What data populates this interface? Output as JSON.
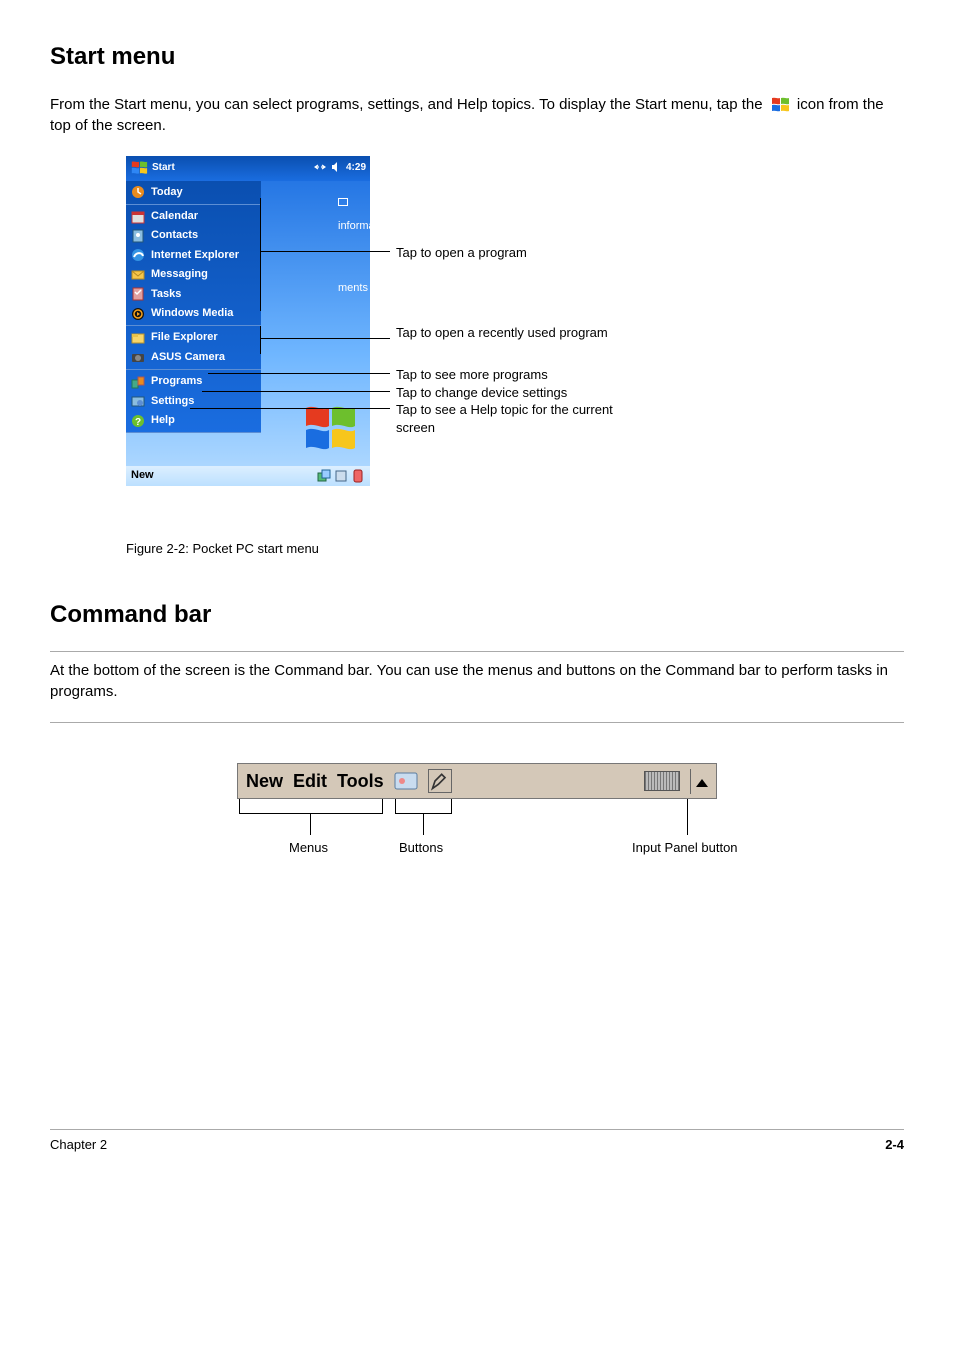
{
  "section1": {
    "title": "Start menu",
    "paragraph_prefix": "From the Start menu, you can select programs, settings, and Help topics. To display the Start menu, tap the ",
    "paragraph_suffix": " icon from the top of the screen."
  },
  "device": {
    "navbar": {
      "start": "Start",
      "time": "4:29"
    },
    "menu_sections": [
      {
        "items": [
          {
            "name": "today",
            "label": "Today"
          }
        ]
      },
      {
        "items": [
          {
            "name": "calendar",
            "label": "Calendar"
          },
          {
            "name": "contacts",
            "label": "Contacts"
          },
          {
            "name": "ie",
            "label": "Internet Explorer"
          },
          {
            "name": "messaging",
            "label": "Messaging"
          },
          {
            "name": "tasks",
            "label": "Tasks"
          },
          {
            "name": "wmp",
            "label": "Windows Media"
          }
        ]
      },
      {
        "items": [
          {
            "name": "file-explorer",
            "label": "File Explorer"
          },
          {
            "name": "asus-camera",
            "label": "ASUS Camera"
          }
        ]
      },
      {
        "items": [
          {
            "name": "programs",
            "label": "Programs"
          },
          {
            "name": "settings",
            "label": "Settings"
          },
          {
            "name": "help",
            "label": "Help"
          }
        ]
      }
    ],
    "peek": {
      "information": "information",
      "ments": "ments"
    },
    "cmdbar_label": "New"
  },
  "callouts": {
    "c1": "Tap to open a program",
    "c2": "Tap to open a recently used program",
    "c3": "Tap to see more programs",
    "c4": "Tap to change device settings",
    "c5": "Tap to see a Help topic for the current screen"
  },
  "caption": "Figure 2-2: Pocket PC start menu",
  "section2": {
    "title": "Command bar",
    "paragraph": "At the bottom of the screen is the Command bar. You can use the menus and buttons on the Command bar to perform tasks in programs."
  },
  "cmdbar_big": {
    "items": [
      "New",
      "Edit",
      "Tools"
    ]
  },
  "cmdbar_callouts": {
    "menus": "Menus",
    "buttons": "Buttons",
    "input_panel": "Input Panel button"
  },
  "footer": {
    "chapter": "Chapter 2",
    "page": "2-4"
  }
}
